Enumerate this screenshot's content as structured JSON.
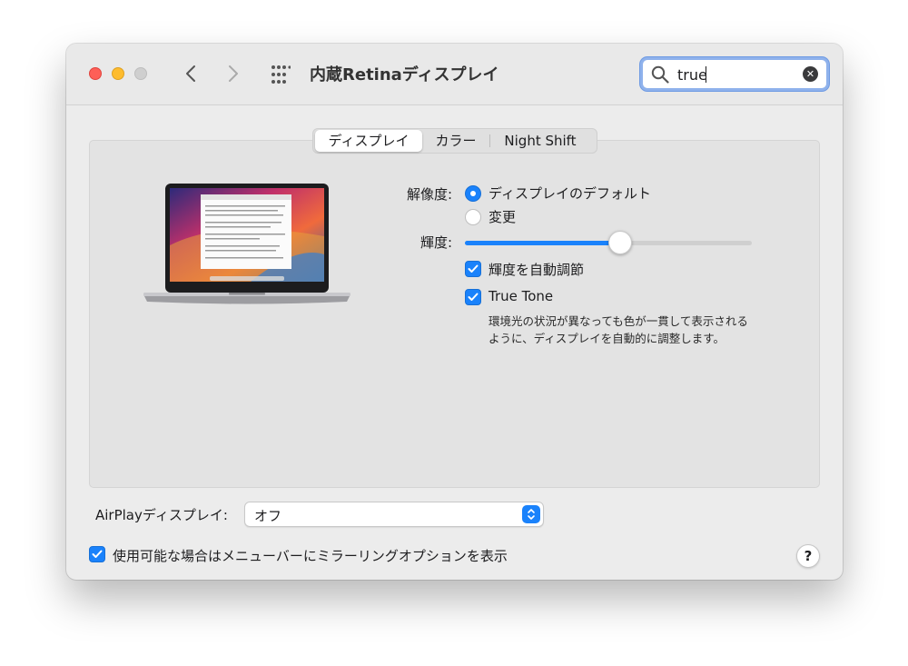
{
  "window": {
    "title": "内蔵Retinaディスプレイ"
  },
  "search": {
    "value": "true"
  },
  "tabs": [
    {
      "label": "ディスプレイ",
      "active": true
    },
    {
      "label": "カラー",
      "active": false
    },
    {
      "label": "Night Shift",
      "active": false
    }
  ],
  "resolution": {
    "label": "解像度:",
    "options": [
      {
        "label": "ディスプレイのデフォルト",
        "selected": true
      },
      {
        "label": "変更",
        "selected": false
      }
    ]
  },
  "brightness": {
    "label": "輝度:",
    "value": 0.54
  },
  "auto_brightness": {
    "label": "輝度を自動調節",
    "checked": true
  },
  "true_tone": {
    "label": "True Tone",
    "checked": true,
    "description_line1": "環境光の状況が異なっても色が一貫して表示される",
    "description_line2": "ように、ディスプレイを自動的に調整します。"
  },
  "airplay": {
    "label": "AirPlayディスプレイ:",
    "value": "オフ"
  },
  "mirroring": {
    "label": "使用可能な場合はメニューバーにミラーリングオプションを表示",
    "checked": true
  },
  "help": {
    "label": "?"
  },
  "colors": {
    "accent": "#1a82fb",
    "close": "#fe5f57",
    "minimize": "#febc2e"
  },
  "icons": [
    "chevron-left-icon",
    "chevron-right-icon",
    "grid-icon",
    "search-icon",
    "clear-icon",
    "checkmark-icon",
    "help-icon"
  ]
}
